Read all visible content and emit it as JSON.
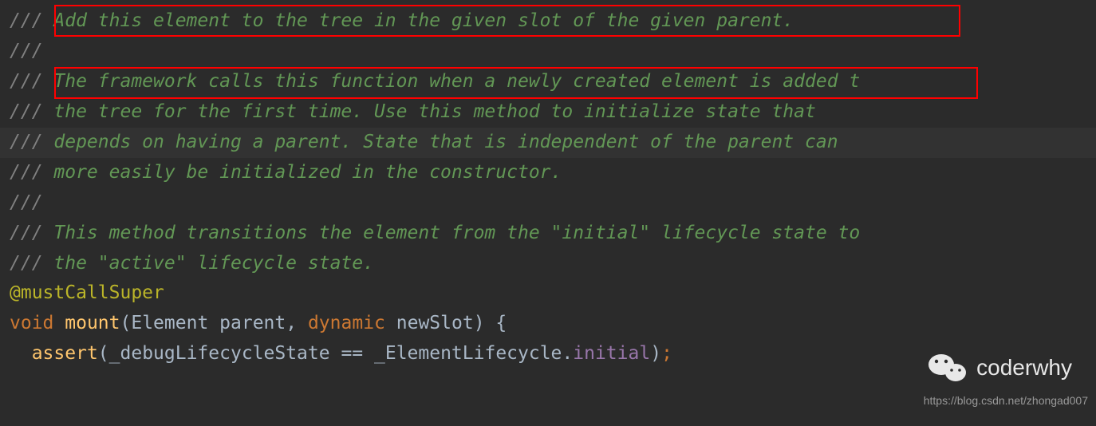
{
  "code": {
    "line1_slash": "///",
    "line1_text": " Add this element to the tree in the given slot of the given parent.",
    "line2_slash": "///",
    "line3_slash": "///",
    "line3_text": " The framework calls this function when a newly created element is added ",
    "line3_text_trail": "t",
    "line4_slash": "///",
    "line4_text": " the tree for the first time. Use this method to initialize state that",
    "line5_slash": "///",
    "line5_text": " depends on having a parent. State that is independent of the parent can",
    "line6_slash": "///",
    "line6_text": " more easily be initialized in the constructor.",
    "line7_slash": "///",
    "line8_slash": "///",
    "line8_text": " This method transitions the element from the \"initial\" lifecycle state to",
    "line9_slash": "///",
    "line9_text": " the \"active\" lifecycle state.",
    "annotation": "@mustCallSuper",
    "void_kw": "void",
    "method_name": "mount",
    "param1_type": "Element",
    "param1_name": "parent",
    "comma": ", ",
    "dynamic_kw": "dynamic",
    "param2_name": "newSlot",
    "brace_open": ") {",
    "assert_call": "assert",
    "assert_open": "(",
    "debug_var": "_debugLifecycleState",
    "eq_op": " == ",
    "enum_class": "_ElementLifecycle",
    "dot": ".",
    "enum_val": "initial",
    "assert_close": ")",
    "semi": ";"
  },
  "watermark": {
    "name": "coderwhy",
    "url": "https://blog.csdn.net/zhongad007"
  }
}
